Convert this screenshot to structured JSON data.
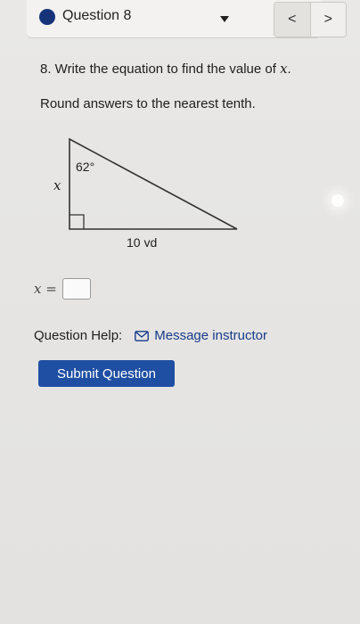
{
  "header": {
    "question_label": "Question 8",
    "prev_icon": "chevron-left-icon",
    "next_icon": "chevron-right-icon",
    "prev_glyph": "<",
    "next_glyph": ">",
    "status_dot_color": "#16337a"
  },
  "question": {
    "prompt_prefix": "8. Write the equation to find the value of ",
    "prompt_var": "x",
    "prompt_suffix": ".",
    "instruction": "Round answers to the nearest tenth.",
    "figure": {
      "angle_label": "62°",
      "side_label": "x",
      "base_label": "10 yd"
    }
  },
  "answer": {
    "var_label": "x =",
    "value": ""
  },
  "help": {
    "label": "Question Help:",
    "link_icon": "mail-icon",
    "link_text": "Message instructor"
  },
  "submit": {
    "label": "Submit Question",
    "color": "#1f4fa3"
  }
}
